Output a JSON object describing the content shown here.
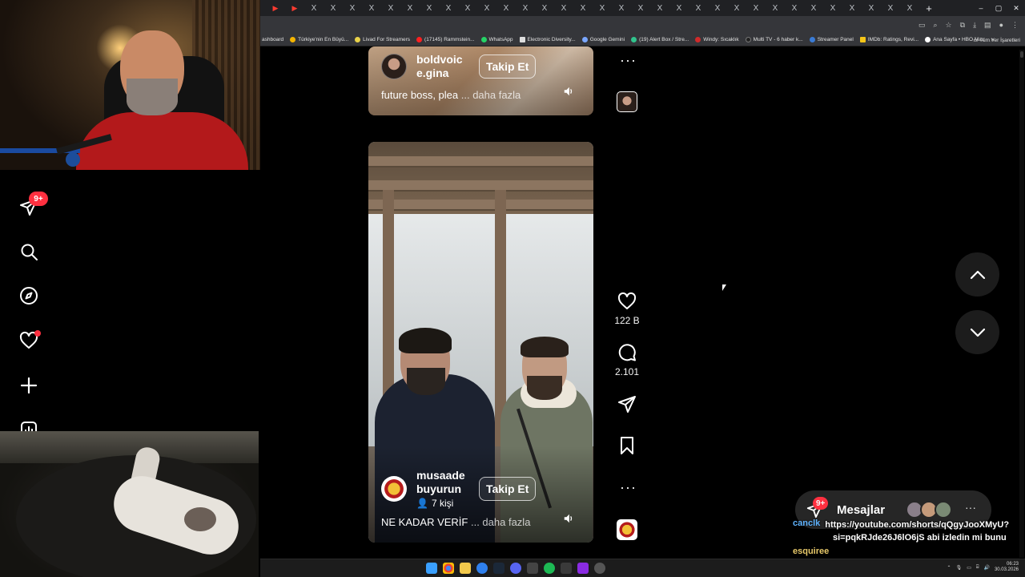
{
  "browser": {
    "tabs": [
      "▶",
      "▶",
      "X",
      "X",
      "X",
      "X",
      "X",
      "X",
      "X",
      "X",
      "X",
      "X",
      "X",
      "X",
      "X",
      "X",
      "X",
      "X",
      "X",
      "X",
      "X",
      "X",
      "X",
      "X",
      "X",
      "X",
      "X",
      "X",
      "X",
      "X",
      "X",
      "X",
      "X",
      "X",
      "X",
      "X",
      "X",
      "X",
      "X",
      "X"
    ],
    "new_tab": "+",
    "window_controls": [
      "–",
      "▢",
      "✕"
    ],
    "bookmarks": [
      "ashboard",
      "Türkiye'nin En Büyü...",
      "Livad For Streamers",
      "(17145) Rammstein...",
      "WhatsApp",
      "Electronic Diversity...",
      "Google Gemini",
      "(19) Alert Box / Stre...",
      "Windy: Sıcaklık",
      "Multi TV - 6 haber k...",
      "Streamer Panel",
      "IMDb: Ratings, Revi...",
      "Ana Sayfa • HBO Max"
    ],
    "bookmarks_more": "»",
    "bookmarks_folder": "Tüm Yer İşaretleri"
  },
  "left_nav": {
    "messages_badge": "9+"
  },
  "reels": [
    {
      "handle": "boldvoic e.gina",
      "follow_label": "Takip Et",
      "caption": "future boss, plea",
      "more_label": "... daha fazla"
    },
    {
      "handle": "musaade buyurun",
      "followers": "7 kişi",
      "follow_label": "Takip Et",
      "caption": "NE KADAR VERİF",
      "more_label": "... daha fazla"
    }
  ],
  "actions": {
    "likes": "122 B",
    "comments": "2.101"
  },
  "messages": {
    "label": "Mesajlar",
    "badge": "9+",
    "more": "···"
  },
  "chat": [
    {
      "user": "canclk",
      "text": "https://youtube.com/shorts/qQgyJooXMyU?"
    },
    {
      "user": "",
      "text": "si=pqkRJde26J6lO6jS abi izledin mi bunu"
    },
    {
      "user": "esquiree",
      "text": ""
    },
    {
      "user": "esquiree",
      "text": ""
    }
  ],
  "taskbar": {
    "time": "06:23",
    "date": "30.03.2026"
  },
  "colors": {
    "accent_red": "#ff3040",
    "background": "#000000",
    "pill": "#262626"
  }
}
